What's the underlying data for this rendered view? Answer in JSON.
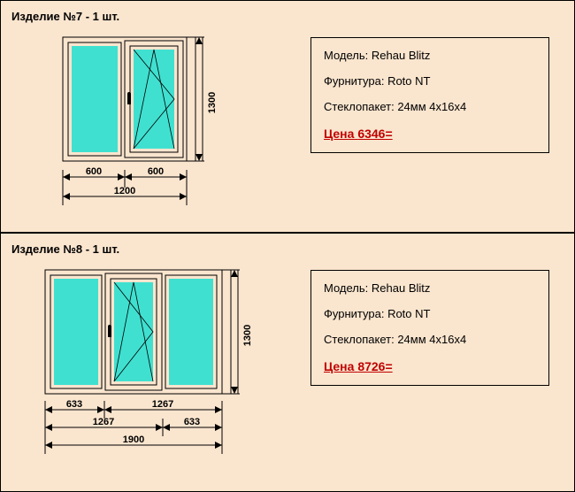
{
  "products": [
    {
      "title": "Изделие №7 - 1 шт.",
      "model_label": "Модель:",
      "model_value": "Rehau Blitz",
      "hardware_label": "Фурнитура:",
      "hardware_value": "Roto NT",
      "glazing_label": "Стеклопакет:",
      "glazing_value": "24мм 4х16х4",
      "price_label": "Цена",
      "price_value": "6346=",
      "dims": {
        "height": "1300",
        "w1": "600",
        "w2": "600",
        "total_w": "1200"
      }
    },
    {
      "title": "Изделие №8 - 1 шт.",
      "model_label": "Модель:",
      "model_value": "Rehau Blitz",
      "hardware_label": "Фурнитура:",
      "hardware_value": "Roto NT",
      "glazing_label": "Стеклопакет:",
      "glazing_value": "24мм 4х16х4",
      "price_label": "Цена",
      "price_value": "8726=",
      "dims": {
        "height": "1300",
        "w1": "633",
        "w2": "1267",
        "w3": "1267",
        "w4": "633",
        "total_w": "1900"
      }
    }
  ]
}
